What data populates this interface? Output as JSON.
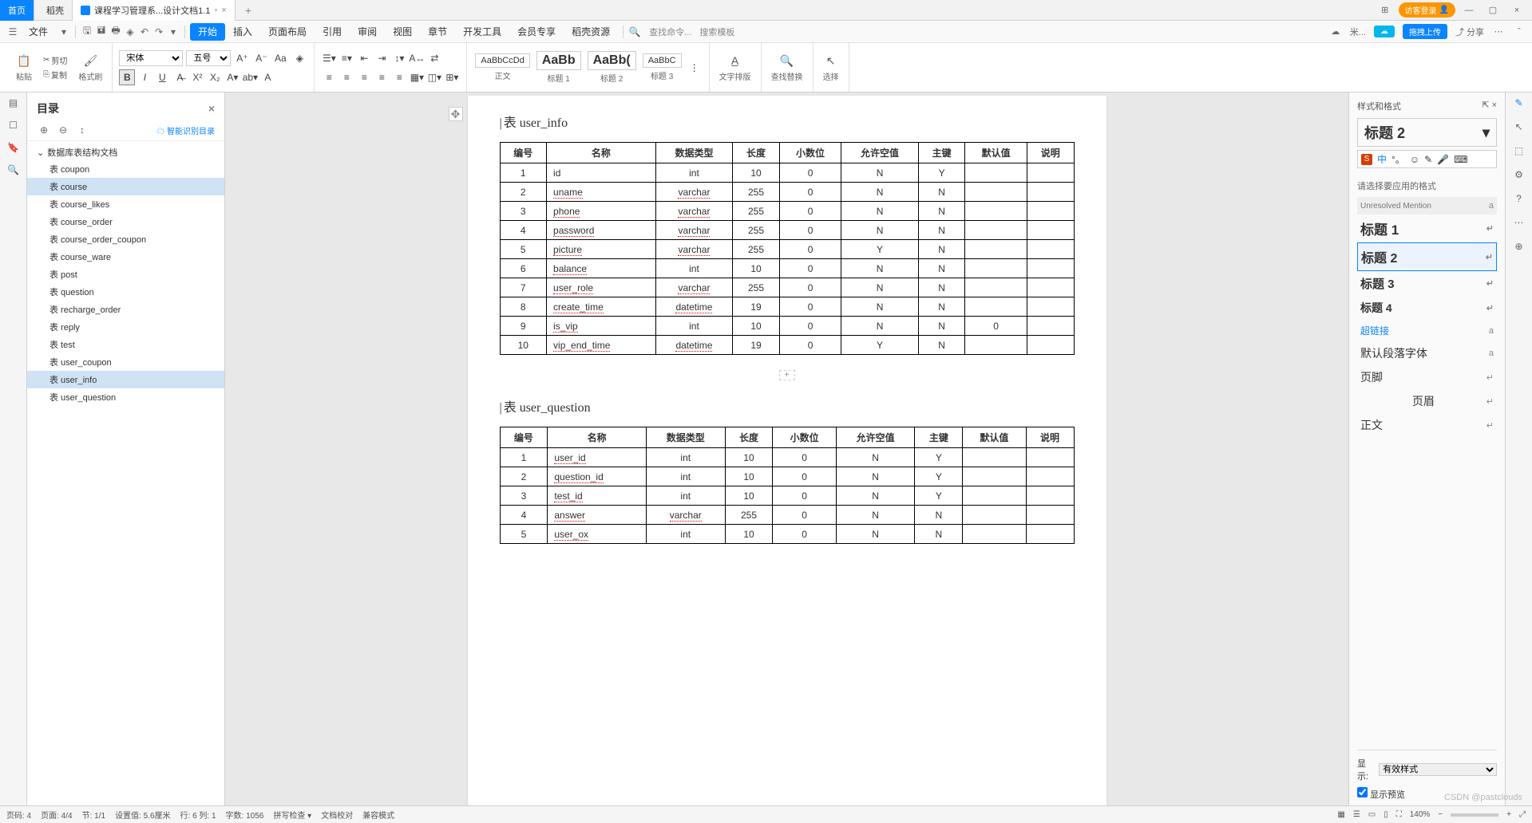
{
  "titlebar": {
    "tabs": [
      {
        "label": "首页",
        "home": true
      },
      {
        "label": "稻壳"
      },
      {
        "label": "课程学习管理系...设计文档1.1",
        "active": true
      }
    ],
    "login": "访客登录"
  },
  "menu": {
    "file": "文件",
    "items": [
      "开始",
      "插入",
      "页面布局",
      "引用",
      "审阅",
      "视图",
      "章节",
      "开发工具",
      "会员专享",
      "稻壳资源"
    ],
    "active": "开始",
    "search_cmd": "查找命令...",
    "search_tpl": "搜索模板",
    "upload": "拖拽上传",
    "share": "分享"
  },
  "ribbon": {
    "paste": "粘贴",
    "cut": "剪切",
    "copy": "复制",
    "format_brush": "格式刷",
    "font": "宋体",
    "size": "五号",
    "styles": [
      {
        "preview": "AaBbCcDd",
        "label": "正文"
      },
      {
        "preview": "AaBb",
        "label": "标题 1",
        "big": true
      },
      {
        "preview": "AaBb(",
        "label": "标题 2",
        "big": true
      },
      {
        "preview": "AaBbC",
        "label": "标题 3"
      }
    ],
    "text_layout": "文字排版",
    "find_replace": "查找替换",
    "select": "选择"
  },
  "sidebar": {
    "title": "目录",
    "smart": "智能识别目录",
    "root": "数据库表结构文档",
    "items": [
      "表 coupon",
      "表 course",
      "表 course_likes",
      "表 course_order",
      "表 course_order_coupon",
      "表 course_ware",
      "表 post",
      "表 question",
      "表 recharge_order",
      "表 reply",
      "表 test",
      "表 user_coupon",
      "表 user_info",
      "表 user_question"
    ],
    "selected": [
      "表 course",
      "表 user_info"
    ]
  },
  "document": {
    "heading1": "表 user_info",
    "columns": [
      "编号",
      "名称",
      "数据类型",
      "长度",
      "小数位",
      "允许空值",
      "主键",
      "默认值",
      "说明"
    ],
    "table1": [
      [
        "1",
        "id",
        "int",
        "10",
        "0",
        "N",
        "Y",
        "",
        ""
      ],
      [
        "2",
        "uname",
        "varchar",
        "255",
        "0",
        "N",
        "N",
        "",
        ""
      ],
      [
        "3",
        "phone",
        "varchar",
        "255",
        "0",
        "N",
        "N",
        "",
        ""
      ],
      [
        "4",
        "password",
        "varchar",
        "255",
        "0",
        "N",
        "N",
        "",
        ""
      ],
      [
        "5",
        "picture",
        "varchar",
        "255",
        "0",
        "Y",
        "N",
        "",
        ""
      ],
      [
        "6",
        "balance",
        "int",
        "10",
        "0",
        "N",
        "N",
        "",
        ""
      ],
      [
        "7",
        "user_role",
        "varchar",
        "255",
        "0",
        "N",
        "N",
        "",
        ""
      ],
      [
        "8",
        "create_time",
        "datetime",
        "19",
        "0",
        "N",
        "N",
        "",
        ""
      ],
      [
        "9",
        "is_vip",
        "int",
        "10",
        "0",
        "N",
        "N",
        "0",
        ""
      ],
      [
        "10",
        "vip_end_time",
        "datetime",
        "19",
        "0",
        "Y",
        "N",
        "",
        ""
      ]
    ],
    "heading2": "表 user_question",
    "table2": [
      [
        "1",
        "user_id",
        "int",
        "10",
        "0",
        "N",
        "Y",
        "",
        ""
      ],
      [
        "2",
        "question_id",
        "int",
        "10",
        "0",
        "N",
        "Y",
        "",
        ""
      ],
      [
        "3",
        "test_id",
        "int",
        "10",
        "0",
        "N",
        "Y",
        "",
        ""
      ],
      [
        "4",
        "answer",
        "varchar",
        "255",
        "0",
        "N",
        "N",
        "",
        ""
      ],
      [
        "5",
        "user_ox",
        "int",
        "10",
        "0",
        "N",
        "N",
        "",
        ""
      ]
    ]
  },
  "right_panel": {
    "header": "样式和格式",
    "current": "标题 2",
    "hint": "请选择要应用的格式",
    "list": [
      {
        "label": "Unresolved Mention",
        "cls": "mention",
        "ret": "a"
      },
      {
        "label": "标题 1",
        "cls": "h1",
        "ret": "↵"
      },
      {
        "label": "标题 2",
        "cls": "h2",
        "ret": "↵",
        "selected": true
      },
      {
        "label": "标题 3",
        "cls": "h3",
        "ret": "↵"
      },
      {
        "label": "标题 4",
        "cls": "h4",
        "ret": "↵"
      },
      {
        "label": "超链接",
        "cls": "link",
        "ret": "a"
      },
      {
        "label": "默认段落字体",
        "cls": "",
        "ret": "a"
      },
      {
        "label": "页脚",
        "cls": "",
        "ret": "↵"
      },
      {
        "label": "页眉",
        "cls": "",
        "ret": "↵",
        "center": true
      },
      {
        "label": "正文",
        "cls": "",
        "ret": "↵"
      }
    ],
    "show_label": "显示:",
    "show_value": "有效样式",
    "preview": "显示预览"
  },
  "statusbar": {
    "items": [
      "页码: 4",
      "页面: 4/4",
      "节: 1/1",
      "设置值: 5.6厘米",
      "行: 6  列: 1",
      "字数: 1056",
      "拼写检查 ▾",
      "文档校对",
      "兼容模式"
    ],
    "zoom": "140%"
  },
  "watermark": "CSDN @pastclouds"
}
